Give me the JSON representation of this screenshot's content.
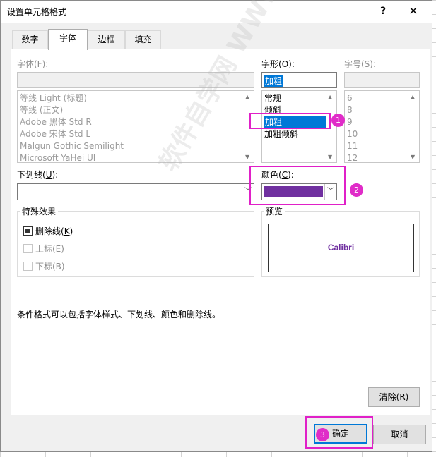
{
  "dialog": {
    "title": "设置单元格格式",
    "help": "?",
    "close": "✕"
  },
  "tabs": [
    {
      "label": "数字"
    },
    {
      "label": "字体"
    },
    {
      "label": "边框"
    },
    {
      "label": "填充"
    }
  ],
  "font": {
    "label": "字体(F):",
    "value": "",
    "items": [
      "等线 Light (标题)",
      "等线 (正文)",
      "Adobe 黑体 Std R",
      "Adobe 宋体 Std L",
      "Malgun Gothic Semilight",
      "Microsoft YaHei UI"
    ]
  },
  "style": {
    "label": "字形(",
    "label_key": "O",
    "label_end": "):",
    "value": "加粗",
    "items": [
      "常规",
      "倾斜",
      "加粗",
      "加粗倾斜"
    ],
    "selected": "加粗"
  },
  "size": {
    "label": "字号(S):",
    "value": "",
    "items": [
      "6",
      "8",
      "9",
      "10",
      "11",
      "12"
    ]
  },
  "underline": {
    "label": "下划线(",
    "label_key": "U",
    "label_end": "):",
    "value": ""
  },
  "color": {
    "label": "颜色(",
    "label_key": "C",
    "label_end": "):",
    "swatch": "#7030a0"
  },
  "effects": {
    "title": "特殊效果",
    "strikethrough": {
      "label": "删除线(",
      "key": "K",
      "end": ")",
      "checked": true
    },
    "superscript": {
      "label": "上标(E)",
      "checked": false
    },
    "subscript": {
      "label": "下标(B)",
      "checked": false
    }
  },
  "preview": {
    "title": "预览",
    "text": "Calibri"
  },
  "note": "条件格式可以包括字体样式、下划线、颜色和删除线。",
  "buttons": {
    "clear": "清除(",
    "clear_key": "R",
    "clear_end": ")",
    "ok": "确定",
    "cancel": "取消"
  },
  "callouts": [
    "1",
    "2",
    "3"
  ],
  "highlight_color": "#e020c8",
  "watermark": "软件自学网 WWW.RJZXW.COM"
}
